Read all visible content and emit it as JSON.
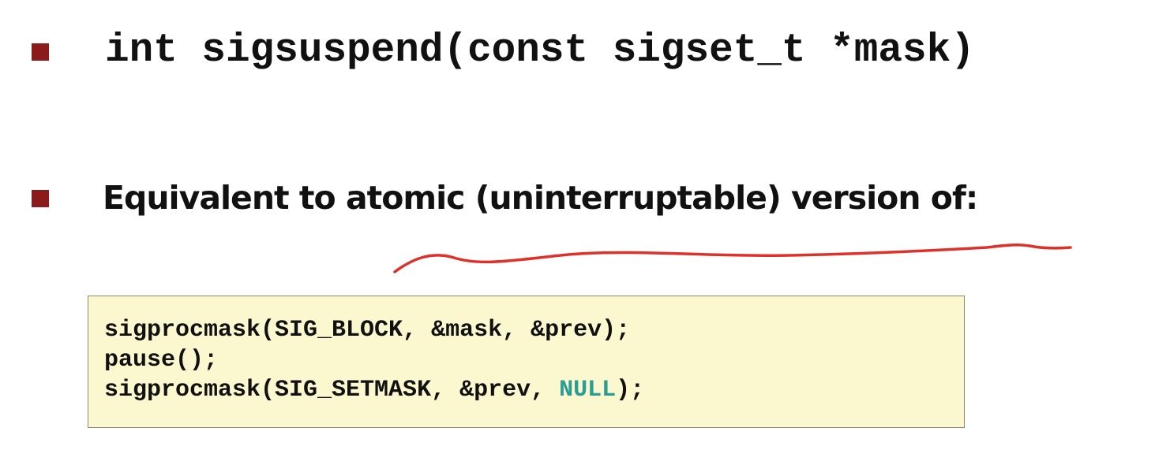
{
  "bullets": {
    "signature": "int sigsuspend(const sigset_t *mask)",
    "description": "Equivalent to atomic (uninterruptable) version of:"
  },
  "code": {
    "line1": "sigprocmask(SIG_BLOCK, &mask, &prev);",
    "line2": "pause();",
    "line3_before": "sigprocmask(SIG_SETMASK, &prev, ",
    "line3_null": "NULL",
    "line3_after": ");"
  },
  "colors": {
    "bullet": "#8b1a1a",
    "code_background": "#fbf7cf",
    "null_keyword": "#2a9d96",
    "annotation_stroke": "#e0302a"
  }
}
